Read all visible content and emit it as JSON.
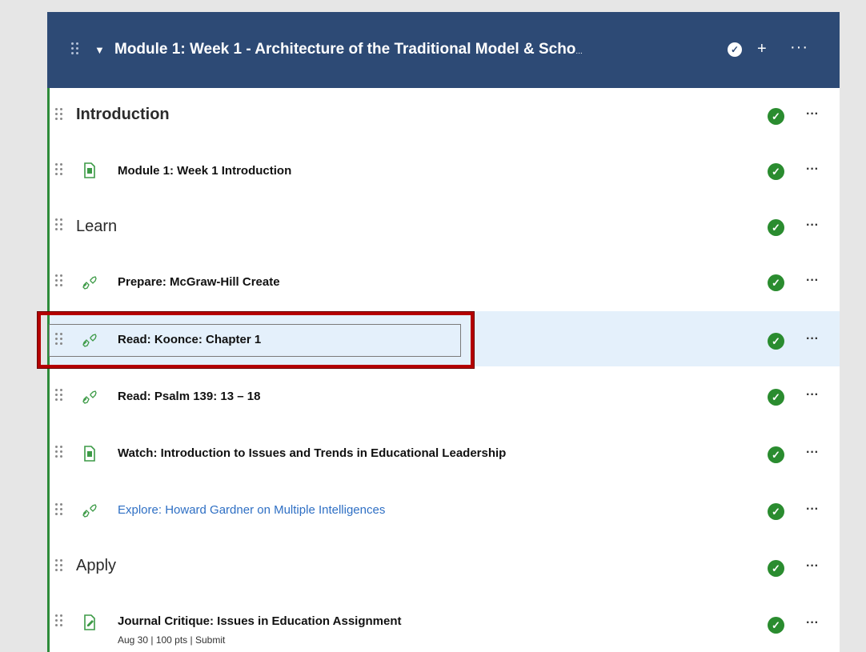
{
  "module": {
    "title": "Module 1: Week 1 - Architecture of the Traditional Model & Scho",
    "title_ellipsis": "...",
    "caret_icon": "caret-down-icon",
    "complete_icon": "check-circle-icon",
    "add_icon": "plus-icon",
    "add_label": "+",
    "more_label": "···"
  },
  "rows": [
    {
      "kind": "section",
      "title": "Introduction"
    },
    {
      "kind": "item",
      "icon": "document-icon",
      "title": "Module 1: Week 1 Introduction"
    },
    {
      "kind": "section",
      "title": "Learn"
    },
    {
      "kind": "item",
      "icon": "link-icon",
      "title": "Prepare: McGraw-Hill Create"
    },
    {
      "kind": "item",
      "icon": "link-icon",
      "title": "Read: Koonce: Chapter 1",
      "selected": true
    },
    {
      "kind": "item",
      "icon": "link-icon",
      "title": "Read: Psalm 139: 13 – 18"
    },
    {
      "kind": "item",
      "icon": "document-icon",
      "title": "Watch: Introduction to Issues and Trends in Educational Leadership"
    },
    {
      "kind": "item",
      "icon": "link-icon",
      "title": "Explore: Howard Gardner on Multiple Intelligences",
      "is_link": true
    },
    {
      "kind": "section",
      "title": "Apply"
    },
    {
      "kind": "item",
      "icon": "assignment-icon",
      "title": "Journal Critique: Issues in Education Assignment",
      "meta": "Aug 30  |  100 pts  |  Submit"
    }
  ],
  "row_actions": {
    "published_icon": "check-circle-icon",
    "more_label": "···"
  },
  "colors": {
    "header_bg": "#2d4a75",
    "published_green": "#2a8c2f",
    "selected_row_bg": "#e4f0fb",
    "highlight_red": "#b40000",
    "link_blue": "#2e6fc4"
  }
}
